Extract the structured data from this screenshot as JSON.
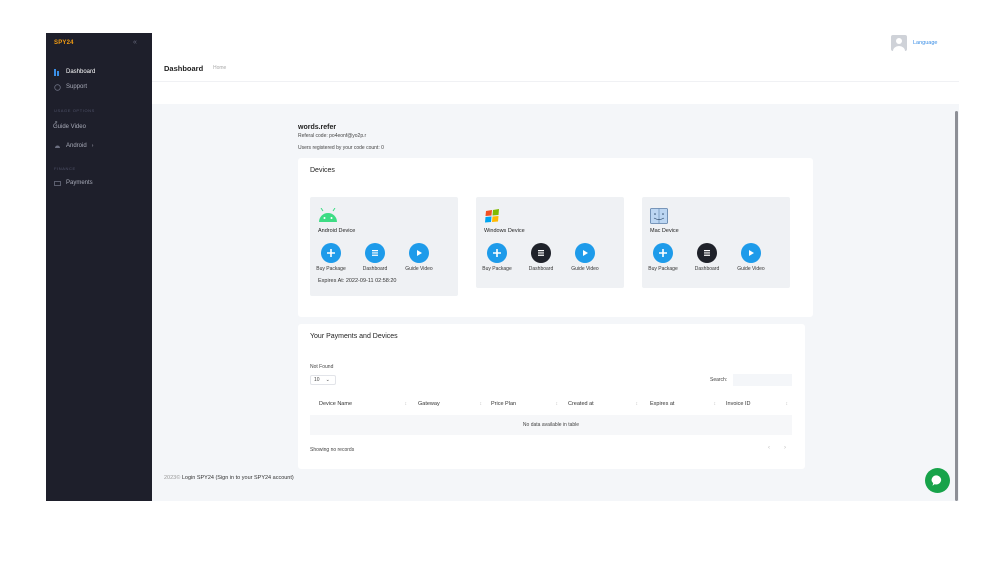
{
  "sidebar": {
    "logo": "SPY24",
    "collapse_glyph": "«",
    "items": [
      {
        "label": "Dashboard"
      },
      {
        "label": "Support"
      }
    ],
    "section_usage": "USAGE OPTIONS",
    "guide_video": "Guide Video",
    "android": "Android",
    "section_finance": "FINANCE",
    "payments": "Payments"
  },
  "topbar": {
    "title": "Dashboard",
    "breadcrumb": "Home",
    "language": "Language"
  },
  "user": {
    "name": "words.refer",
    "referral": "Referal code: po4eonf@yo2p.r",
    "registered": "Users registered by your code count: 0"
  },
  "devices": {
    "title": "Devices",
    "buy_label": "Buy Package",
    "dashboard_label": "Dashboard",
    "guide_label": "Guide Video",
    "android": {
      "name": "Android Device",
      "expires": "Expires At: 2022-09-11 02:58:20"
    },
    "windows": {
      "name": "Windows Device"
    },
    "mac": {
      "name": "Mac Device"
    }
  },
  "payments": {
    "title": "Your Payments and Devices",
    "not_found": "Not Found",
    "page_size": "10",
    "search_label": "Search:",
    "columns": [
      "Device Name",
      "Gateway",
      "Price Plan",
      "Created at",
      "Expires at",
      "Invoice ID"
    ],
    "empty": "No data available in table",
    "showing": "Showing no records",
    "prev": "‹",
    "next": "›"
  },
  "footer": {
    "year": "2023©",
    "text": "Login SPY24 (Sign in to your SPY24 account)"
  },
  "colors": {
    "sidebar": "#1e1f2b",
    "accent_blue": "#1e9bea",
    "chat_green": "#17a34a"
  },
  "icons": [
    "grid-icon",
    "support-icon",
    "video-icon",
    "android-icon",
    "windows-icon",
    "apple-icon",
    "plus-icon",
    "list-icon",
    "play-icon",
    "wallet-icon",
    "chat-icon",
    "avatar-icon"
  ]
}
